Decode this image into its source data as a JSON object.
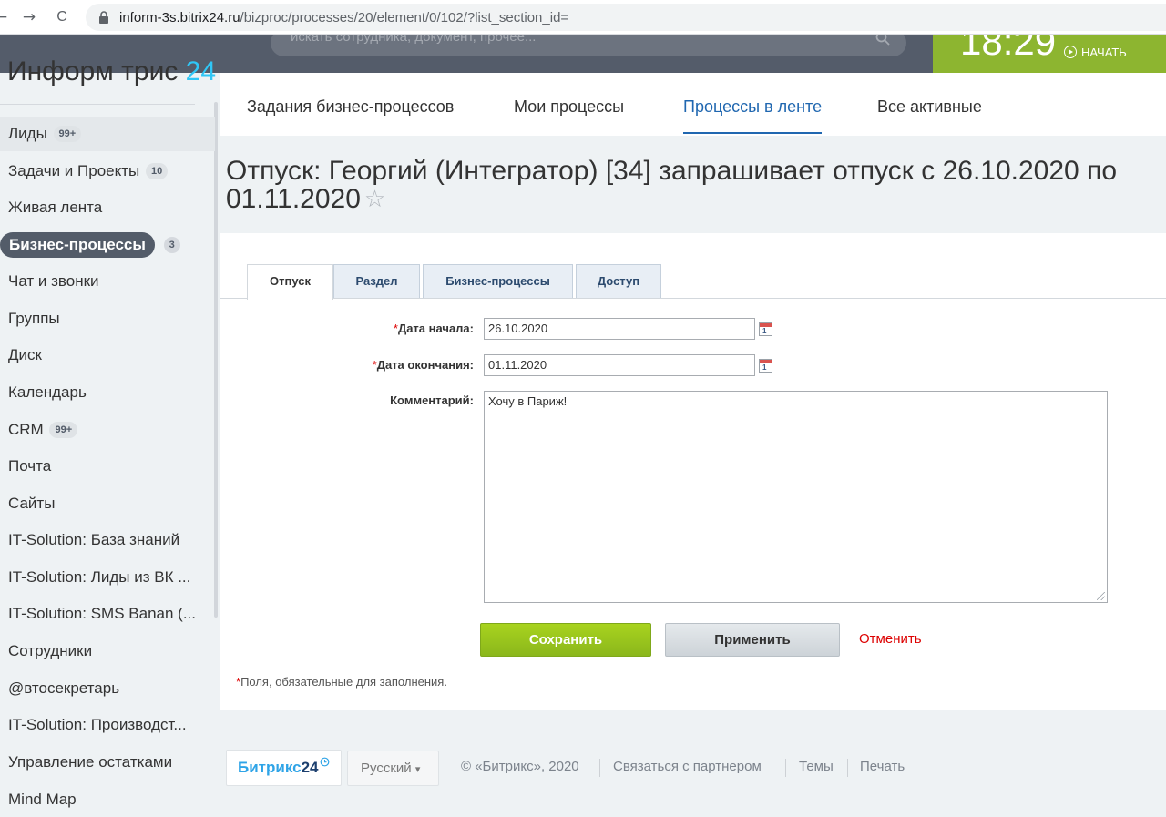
{
  "browser": {
    "back": "←",
    "forward": "→",
    "reload": "C",
    "url_domain": "inform-3s.bitrix24.ru",
    "url_path": "/bizproc/processes/20/element/0/102/?list_section_id="
  },
  "header": {
    "logo_text": "Информ трис",
    "logo_num": "24",
    "search_placeholder": "искать сотрудника, документ, прочее...",
    "clock": "18:29",
    "start_label": "НАЧАТЬ"
  },
  "sidebar": {
    "items": [
      {
        "label": "Лиды",
        "counter": "99+"
      },
      {
        "label": "Задачи и Проекты",
        "counter": "10"
      },
      {
        "label": "Живая лента",
        "counter": ""
      },
      {
        "label": "Бизнес-процессы",
        "counter": "3"
      },
      {
        "label": "Чат и звонки",
        "counter": ""
      },
      {
        "label": "Группы",
        "counter": ""
      },
      {
        "label": "Диск",
        "counter": ""
      },
      {
        "label": "Календарь",
        "counter": ""
      },
      {
        "label": "CRM",
        "counter": "99+"
      },
      {
        "label": "Почта",
        "counter": ""
      },
      {
        "label": "Сайты",
        "counter": ""
      },
      {
        "label": "IT-Solution: База знаний",
        "counter": ""
      },
      {
        "label": "IT-Solution: Лиды из ВК ...",
        "counter": ""
      },
      {
        "label": "IT-Solution: SMS Banan (...",
        "counter": ""
      },
      {
        "label": "Сотрудники",
        "counter": ""
      },
      {
        "label": "@втосекретарь",
        "counter": ""
      },
      {
        "label": "IT-Solution: Производст...",
        "counter": ""
      },
      {
        "label": "Управление остатками",
        "counter": ""
      },
      {
        "label": "Mind Map",
        "counter": ""
      }
    ]
  },
  "top_tabs": [
    "Задания бизнес-процессов",
    "Мои процессы",
    "Процессы в ленте",
    "Все активные"
  ],
  "page": {
    "title": "Отпуск: Георгий (Интегратор) [34] запрашивает отпуск с 26.10.2020 по 01.11.2020",
    "star": "☆"
  },
  "form": {
    "tabs": [
      "Отпуск",
      "Раздел",
      "Бизнес-процессы",
      "Доступ"
    ],
    "required_mark": "*",
    "start_label": "Дата начала:",
    "start_value": "26.10.2020",
    "end_label": "Дата окончания:",
    "end_value": "01.11.2020",
    "comment_label": "Комментарий:",
    "comment_value": "Хочу в Париж!",
    "calendar_day": "1",
    "save": "Сохранить",
    "apply": "Применить",
    "cancel": "Отменить",
    "required_note": "Поля, обязательные для заполнения."
  },
  "footer": {
    "logo_text": "Битрикс",
    "logo_num": "24",
    "language": "Русский",
    "language_arrow": "▾",
    "copyright": "© «Битрикс», 2020",
    "partner": "Связаться с партнером",
    "themes": "Темы",
    "print": "Печать"
  },
  "colors": {
    "accent": "#2067b0",
    "header": "#545c6a",
    "time_block": "#8db530",
    "save_button": "#9bc51c",
    "cancel_link": "#dd0000"
  }
}
